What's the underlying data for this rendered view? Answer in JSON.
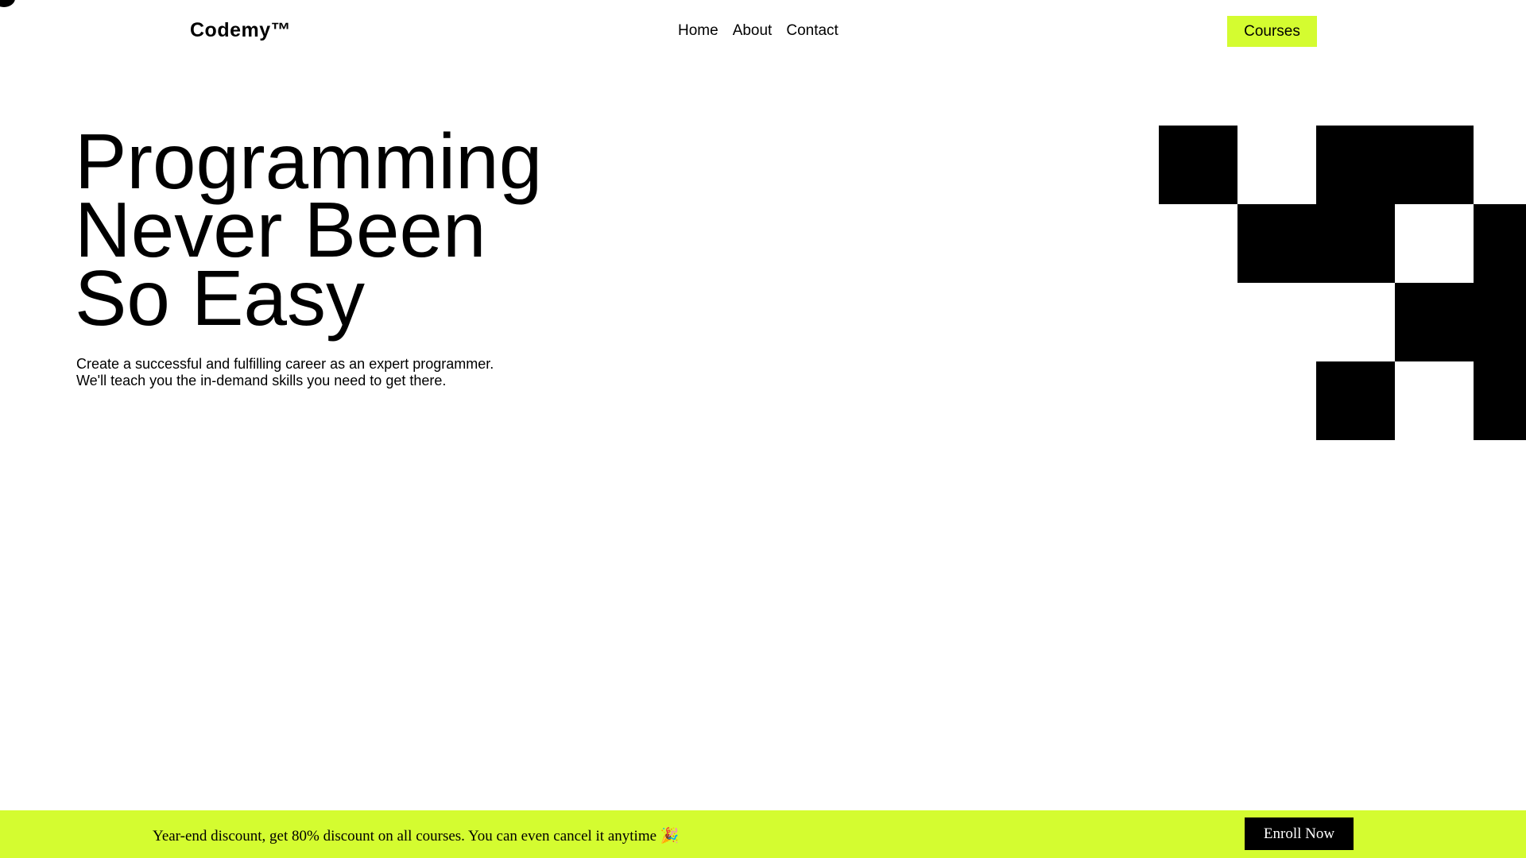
{
  "header": {
    "logo": "Codemy™",
    "nav": [
      "Home",
      "About",
      "Contact"
    ],
    "cta_label": "Courses"
  },
  "hero": {
    "title_lines": [
      "Programming",
      "Never Been",
      "So Easy"
    ],
    "subtitle_lines": [
      "Create a successful and fulfilling career as an expert programmer.",
      "We'll teach you the in-demand skills you need to get there."
    ]
  },
  "banner": {
    "text": "Year-end discount, get 80% discount on all courses. You can even cancel it anytime 🎉",
    "cta_label": "Enroll Now"
  },
  "colors": {
    "accent": "#d4fc30",
    "text": "#000000",
    "background": "#ffffff"
  }
}
